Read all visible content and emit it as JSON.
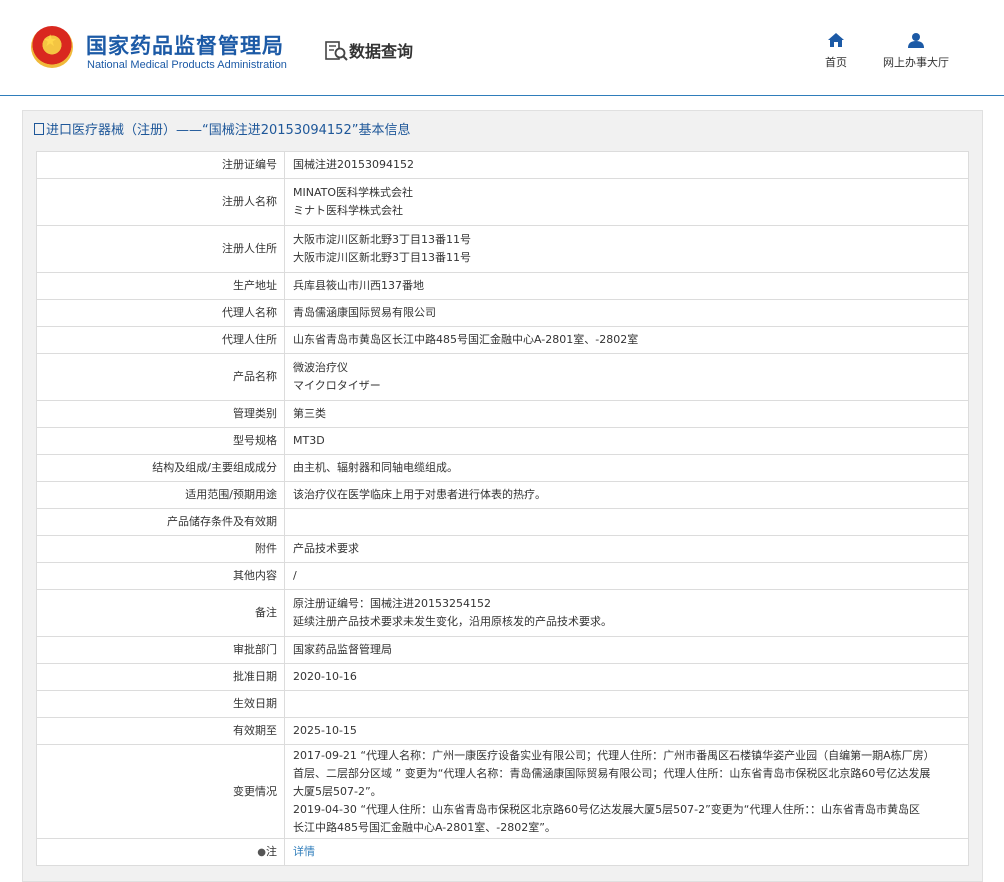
{
  "header": {
    "logo_cn": "国家药品监督管理局",
    "logo_en": "National Medical Products Administration",
    "search_title": "数据查询",
    "nav": [
      {
        "label": "首页",
        "icon": "home-icon"
      },
      {
        "label": "网上办事大厅",
        "icon": "user-icon"
      }
    ]
  },
  "panel": {
    "title": "进口医疗器械（注册）——“国械注进20153094152”基本信息"
  },
  "table": {
    "rows": [
      {
        "label": "注册证编号",
        "lines": [
          "国械注进20153094152"
        ]
      },
      {
        "label": "注册人名称",
        "lines": [
          "MINATO医科学株式会社",
          "ミナト医科学株式会社"
        ]
      },
      {
        "label": "注册人住所",
        "lines": [
          "大阪市淀川区新北野3丁目13番11号",
          "大阪市淀川区新北野3丁目13番11号"
        ]
      },
      {
        "label": "生产地址",
        "lines": [
          "兵库县筱山市川西137番地"
        ]
      },
      {
        "label": "代理人名称",
        "lines": [
          "青岛儒涵康国际贸易有限公司"
        ]
      },
      {
        "label": "代理人住所",
        "lines": [
          "山东省青岛市黄岛区长江中路485号国汇金融中心A-2801室、-2802室"
        ]
      },
      {
        "label": "产品名称",
        "lines": [
          "微波治疗仪",
          "マイクロタイザー"
        ]
      },
      {
        "label": "管理类别",
        "lines": [
          "第三类"
        ]
      },
      {
        "label": "型号规格",
        "lines": [
          "MT3D"
        ]
      },
      {
        "label": "结构及组成/主要组成成分",
        "lines": [
          "由主机、辐射器和同轴电缆组成。"
        ]
      },
      {
        "label": "适用范围/预期用途",
        "lines": [
          "该治疗仪在医学临床上用于对患者进行体表的热疗。"
        ]
      },
      {
        "label": "产品储存条件及有效期",
        "lines": [
          ""
        ]
      },
      {
        "label": "附件",
        "lines": [
          "产品技术要求"
        ]
      },
      {
        "label": "其他内容",
        "lines": [
          "/"
        ]
      },
      {
        "label": "备注",
        "lines": [
          "原注册证编号：国械注进20153254152",
          "延续注册产品技术要求未发生变化，沿用原核发的产品技术要求。"
        ]
      },
      {
        "label": "审批部门",
        "lines": [
          "国家药品监督管理局"
        ]
      },
      {
        "label": "批准日期",
        "lines": [
          "2020-10-16"
        ]
      },
      {
        "label": "生效日期",
        "lines": [
          ""
        ]
      },
      {
        "label": "有效期至",
        "lines": [
          "2025-10-15"
        ]
      },
      {
        "label": "变更情况",
        "lines": [
          "2017-09-21 “代理人名称：广州一康医疗设备实业有限公司；代理人住所：广州市番禺区石楼镇华姿产业园（自编第一期A栋厂房）",
          "首层、二层部分区域 ” 变更为“代理人名称：青岛儒涵康国际贸易有限公司；代理人住所：山东省青岛市保税区北京路60号亿达发展",
          "大厦5层507-2”。",
          "2019-04-30 “代理人住所：山东省青岛市保税区北京路60号亿达发展大厦5层507-2”变更为“代理人住所：：山东省青岛市黄岛区",
          "长江中路485号国汇金融中心A-2801室、-2802室”。"
        ]
      },
      {
        "label": "注",
        "lines": [
          "详情"
        ],
        "label_icon": "lightbulb-icon",
        "link": true
      }
    ]
  }
}
